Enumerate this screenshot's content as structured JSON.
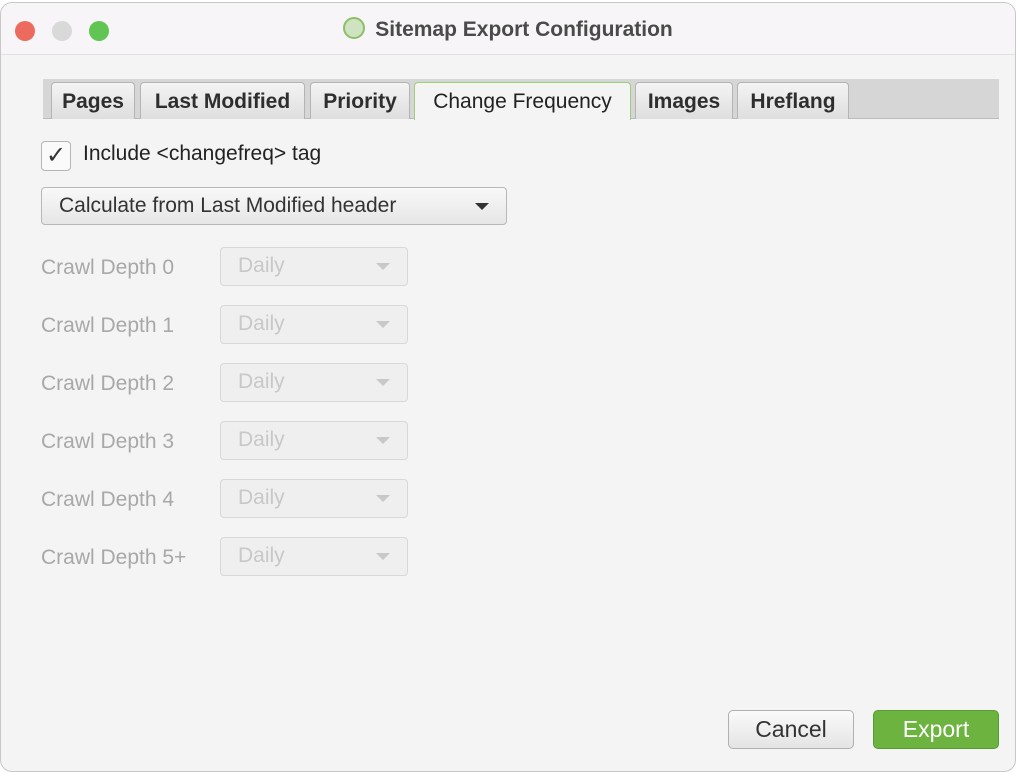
{
  "window": {
    "title": "Sitemap Export Configuration",
    "logo": "app-logo"
  },
  "tabs": [
    {
      "label": "Pages"
    },
    {
      "label": "Last Modified"
    },
    {
      "label": "Priority"
    },
    {
      "label": "Change Frequency",
      "active": true
    },
    {
      "label": "Images"
    },
    {
      "label": "Hreflang"
    }
  ],
  "include_checkbox": {
    "label": "Include <changefreq> tag",
    "checked": true
  },
  "mode_select": {
    "value": "Calculate from Last Modified header"
  },
  "depth_rows": [
    {
      "label": "Crawl Depth 0",
      "value": "Daily"
    },
    {
      "label": "Crawl Depth 1",
      "value": "Daily"
    },
    {
      "label": "Crawl Depth 2",
      "value": "Daily"
    },
    {
      "label": "Crawl Depth 3",
      "value": "Daily"
    },
    {
      "label": "Crawl Depth 4",
      "value": "Daily"
    },
    {
      "label": "Crawl Depth 5+",
      "value": "Daily"
    }
  ],
  "buttons": {
    "cancel": "Cancel",
    "export": "Export"
  },
  "colors": {
    "accent": "#6cb33f",
    "close": "#ec6a5e",
    "minimize": "#d9d9d9",
    "zoom": "#61c554"
  }
}
